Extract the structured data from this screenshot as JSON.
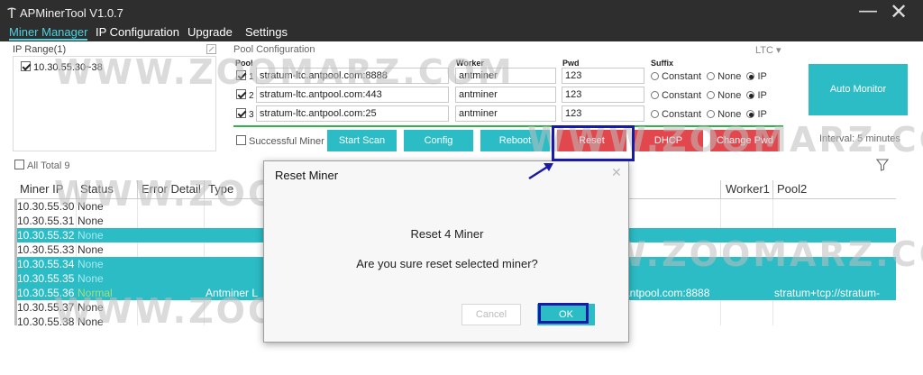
{
  "window": {
    "title": "APMinerTool V1.0.7",
    "minimize_glyph": "—",
    "close_glyph": "✕"
  },
  "menu": [
    {
      "label": "Miner Manager",
      "active": true
    },
    {
      "label": "IP Configuration",
      "active": false
    },
    {
      "label": "Upgrade",
      "active": false
    },
    {
      "label": "Settings",
      "active": false
    }
  ],
  "ip_range": {
    "label": "IP Range(1)",
    "items": [
      "10.30.55.30~38"
    ]
  },
  "pool_config": {
    "label": "Pool Configuration",
    "coin": "LTC",
    "headers": {
      "pool": "Pool",
      "worker": "Worker",
      "pwd": "Pwd",
      "suffix": "Suffix"
    },
    "rows": [
      {
        "num": "1",
        "url": "stratum-ltc.antpool.com:8888",
        "worker": "antminer",
        "pwd": "123"
      },
      {
        "num": "2",
        "url": "stratum-ltc.antpool.com:443",
        "worker": "antminer",
        "pwd": "123"
      },
      {
        "num": "3",
        "url": "stratum-ltc.antpool.com:25",
        "worker": "antminer",
        "pwd": "123"
      }
    ],
    "suffix_options": [
      "Constant",
      "None",
      "IP"
    ]
  },
  "actions": {
    "successful_miner": "Successful Miner",
    "start_scan": "Start Scan",
    "config": "Config",
    "reboot": "Reboot",
    "reset": "Reset",
    "dhcp": "DHCP",
    "change_pwd": "Change Pwd"
  },
  "auto_monitor": {
    "label": "Auto Monitor",
    "interval": "Interval: 5 minutes"
  },
  "list": {
    "all_total": "All Total 9",
    "columns": [
      "Miner IP",
      "Status",
      "Error Detail",
      "Type",
      "Worker1",
      "Pool2"
    ],
    "rows": [
      {
        "ip": "10.30.55.30",
        "status": "None",
        "selected": false
      },
      {
        "ip": "10.30.55.31",
        "status": "None",
        "selected": false
      },
      {
        "ip": "10.30.55.32",
        "status": "None",
        "selected": true
      },
      {
        "ip": "10.30.55.33",
        "status": "None",
        "selected": false
      },
      {
        "ip": "10.30.55.34",
        "status": "None",
        "selected": true
      },
      {
        "ip": "10.30.55.35",
        "status": "None",
        "selected": true
      },
      {
        "ip": "10.30.55.36",
        "status": "Normal",
        "selected": true,
        "type": "Antminer L",
        "pool1": "antpool.com:8888",
        "pool2": "stratum+tcp://stratum-"
      },
      {
        "ip": "10.30.55.37",
        "status": "None",
        "selected": false
      },
      {
        "ip": "10.30.55.38",
        "status": "None",
        "selected": false
      }
    ]
  },
  "dialog": {
    "title": "Reset Miner",
    "close_glyph": "✕",
    "message1": "Reset 4 Miner",
    "message2": "Are you sure reset selected miner?",
    "cancel": "Cancel",
    "ok": "OK"
  },
  "watermark": "WWW.ZOOMARZ.COM",
  "colors": {
    "accent": "#2cbcc6",
    "danger": "#e2474d",
    "titlebar": "#2e2e2e",
    "annotation": "#1a1aa8"
  }
}
